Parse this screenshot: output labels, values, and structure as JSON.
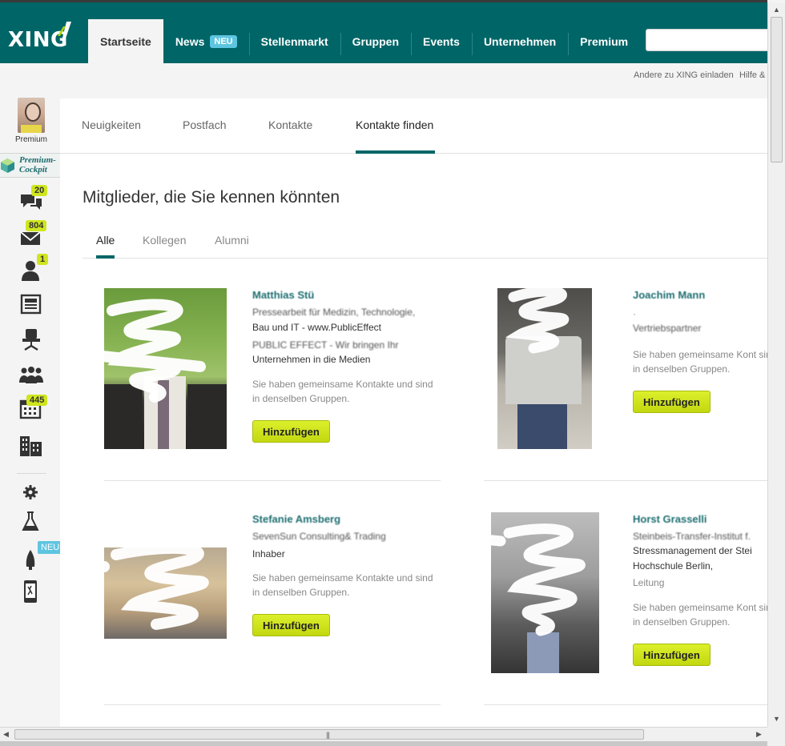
{
  "brand": {
    "name": "XING"
  },
  "nav": {
    "items": [
      {
        "label": "Startseite"
      },
      {
        "label": "News",
        "badge": "NEU"
      },
      {
        "label": "Stellenmarkt"
      },
      {
        "label": "Gruppen"
      },
      {
        "label": "Events"
      },
      {
        "label": "Unternehmen"
      },
      {
        "label": "Premium"
      }
    ],
    "search_value": ""
  },
  "utility": {
    "invite": "Andere zu XING einladen",
    "help": "Hilfe &"
  },
  "sidebar": {
    "user_label": "Premium",
    "cockpit": {
      "line1": "Premium-",
      "line2": "Cockpit"
    },
    "counts": {
      "messages": "20",
      "mail": "804",
      "contacts": "1",
      "events": "445"
    },
    "new_badge": "NEU"
  },
  "subnav": {
    "items": [
      "Neuigkeiten",
      "Postfach",
      "Kontakte",
      "Kontakte finden"
    ]
  },
  "section": {
    "title": "Mitglieder, die Sie kennen könnten",
    "tabs": [
      "Alle",
      "Kollegen",
      "Alumni"
    ]
  },
  "cards": [
    {
      "name": "Matthias Stü",
      "lines": [
        "Pressearbeit für Medizin, Technologie,",
        "Bau und IT - www.PublicEffect",
        "PUBLIC EFFECT - Wir bringen Ihr",
        "Unternehmen in die Medien"
      ],
      "common": "Sie haben gemeinsame Kontakte und sind in denselben Gruppen.",
      "button": "Hinzufügen"
    },
    {
      "name": "Joachim Mann",
      "lines": [
        "·",
        "Vertriebspartner"
      ],
      "common": "Sie haben gemeinsame Kont sind in denselben Gruppen.",
      "button": "Hinzufügen"
    },
    {
      "name": "Stefanie Amsberg",
      "lines": [
        "SevenSun Consulting& Trading",
        "Inhaber"
      ],
      "common": "Sie haben gemeinsame Kontakte und sind in denselben Gruppen.",
      "button": "Hinzufügen"
    },
    {
      "name": "Horst Grasselli",
      "lines": [
        "Steinbeis-Transfer-Institut f.",
        "Stressmanagement der Stei",
        "Hochschule Berlin,",
        "Leitung"
      ],
      "common": "Sie haben gemeinsame Kont sind in denselben Gruppen.",
      "button": "Hinzufügen"
    }
  ],
  "colors": {
    "brand_teal": "#006567",
    "accent_lime": "#cfe51f",
    "neu_blue": "#5ec5e0"
  }
}
